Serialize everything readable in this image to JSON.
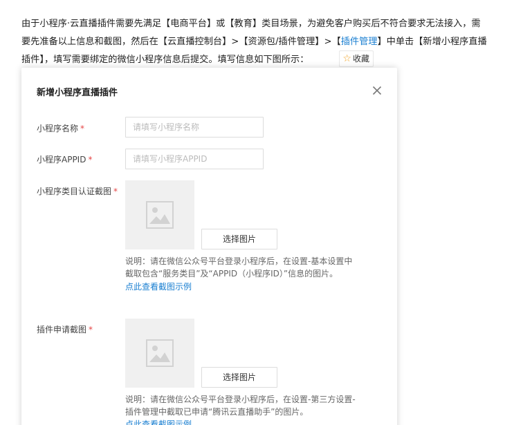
{
  "intro": {
    "line1": "由于小程序·云直播插件需要先满足【电商平台】或【教育】类目场景，为避免客户购买后不符合要求无法接入，需",
    "line2_prefix": "要先准备以上信息和截图，然后在【云直播控制台】>【资源包/插件管理】>【",
    "line2_link": "插件管理",
    "line2_suffix": "】中单击【新增小程序直播",
    "line3": "插件】，填写需要绑定的微信小程序信息后提交。填写信息如下图所示：",
    "favorite_label": "收藏"
  },
  "dialog": {
    "title": "新增小程序直播插件",
    "required_mark": "*",
    "name_label": "小程序名称",
    "name_placeholder": "请填写小程序名称",
    "appid_label": "小程序APPID",
    "appid_placeholder": "请填写小程序APPID",
    "category_label": "小程序类目认证截图",
    "choose_image_label": "选择图片",
    "category_note": "说明：请在微信公众号平台登录小程序后，在设置-基本设置中截取包含“服务类目”及“APPID（小程序ID）”信息的图片。",
    "view_example_link": "点此查看截图示例",
    "plugin_label": "插件申请截图",
    "plugin_note": "说明：请在微信公众号平台登录小程序后，在设置-第三方设置-插件管理中截取已申请“腾讯云直播助手”的图片。",
    "view_example_link2": "点此查看截图示例"
  },
  "colors": {
    "link": "#1a7fd1",
    "required": "#e54545",
    "placeholder": "#bbbbbb",
    "image_bg": "#f0f0f0",
    "star": "#f0a020"
  },
  "icons": {
    "favorite": "star-icon",
    "close": "close-icon",
    "image_placeholder": "image-placeholder-icon"
  }
}
